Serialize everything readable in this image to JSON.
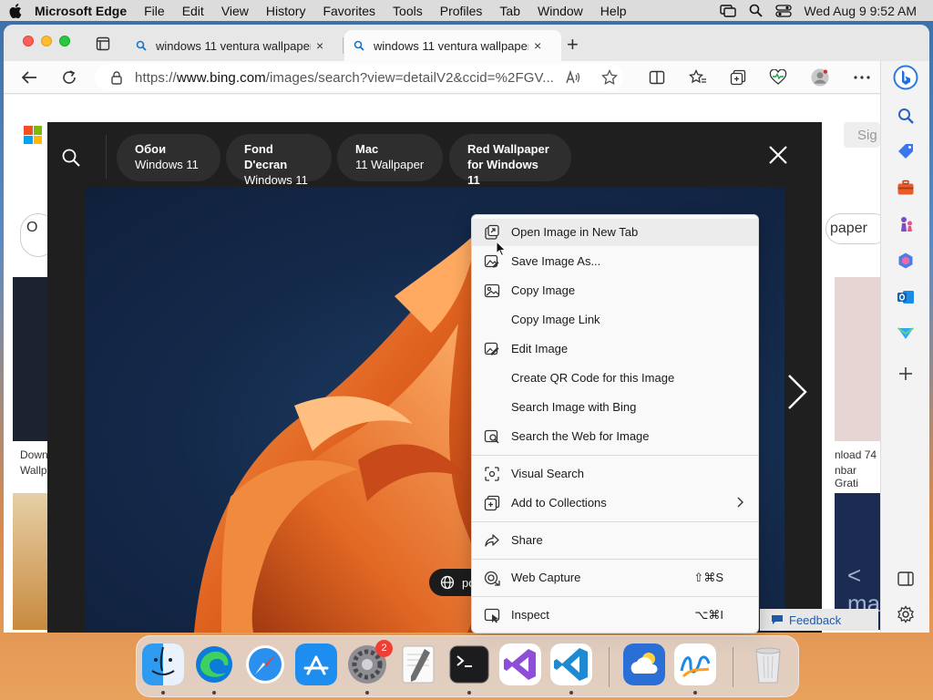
{
  "menubar": {
    "app": "Microsoft Edge",
    "items": [
      "File",
      "Edit",
      "View",
      "History",
      "Favorites",
      "Tools",
      "Profiles",
      "Tab",
      "Window",
      "Help"
    ],
    "clock": "Wed Aug 9  9:52 AM"
  },
  "tabs": [
    {
      "title": "windows 11 ventura wallpaper",
      "close": "×"
    },
    {
      "title": "windows 11 ventura wallpaper",
      "close": "×"
    }
  ],
  "new_tab": "+",
  "urlbar": {
    "prefix": "https://",
    "domain": "www.bing.com",
    "path": "/images/search?view=detailV2&ccid=%2FGV..."
  },
  "viewer": {
    "chips": [
      {
        "line1": "Обои",
        "line2": "Windows 11"
      },
      {
        "line1": "Fond D'ecran",
        "line2": "Windows 11"
      },
      {
        "line1": "Mac",
        "line2": "11 Wallpaper"
      },
      {
        "line1": "Red Wallpaper",
        "line2": "for Windows 11"
      }
    ],
    "source": "posts.id"
  },
  "page": {
    "sign_in": "Sig",
    "right_pill": "paper",
    "left_caption_1": "Down",
    "left_caption_2": "Wallp",
    "right_caption_1": "nload 74",
    "right_caption_2": "nbar Grati",
    "right_bottom": "< ma",
    "pill_left": "O"
  },
  "context_menu": {
    "items": [
      {
        "label": "Open Image in New Tab",
        "icon": "new-tab-icon"
      },
      {
        "label": "Save Image As...",
        "icon": "save-image-icon"
      },
      {
        "label": "Copy Image",
        "icon": "image-icon"
      },
      {
        "label": "Copy Image Link",
        "icon": ""
      },
      {
        "label": "Edit Image",
        "icon": "edit-image-icon"
      },
      {
        "label": "Create QR Code for this Image",
        "icon": ""
      },
      {
        "label": "Search Image with Bing",
        "icon": ""
      },
      {
        "label": "Search the Web for Image",
        "icon": "search-image-icon"
      },
      {
        "label": "Visual Search",
        "icon": "visual-search-icon"
      },
      {
        "label": "Add to Collections",
        "icon": "collections-icon"
      },
      {
        "label": "Share",
        "icon": "share-icon"
      },
      {
        "label": "Web Capture",
        "icon": "web-capture-icon",
        "shortcut": "⇧⌘S"
      },
      {
        "label": "Inspect",
        "icon": "inspect-icon",
        "shortcut": "⌥⌘I"
      }
    ]
  },
  "feedback": "Feedback",
  "dock": {
    "settings_badge": "2"
  }
}
